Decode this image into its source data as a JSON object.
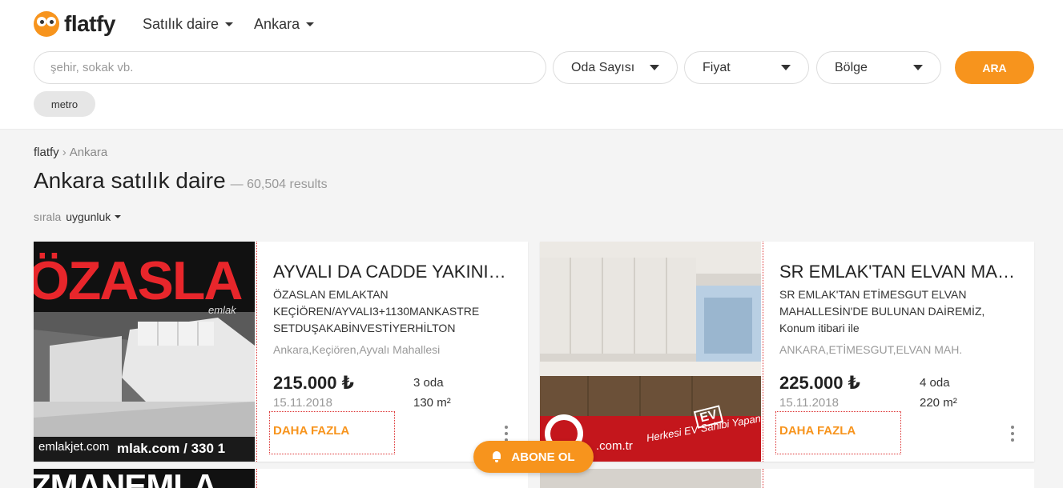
{
  "brand": {
    "name": "flatfy",
    "accent": "#f7941d"
  },
  "nav": {
    "property_type": "Satılık daire",
    "city": "Ankara"
  },
  "search": {
    "placeholder": "şehir, sokak vb.",
    "filters": [
      "Oda Sayısı",
      "Fiyat",
      "Bölge"
    ],
    "submit": "ARA",
    "chip": "metro"
  },
  "breadcrumb": {
    "root": "flatfy",
    "current": "Ankara"
  },
  "page": {
    "title": "Ankara satılık daire",
    "count": "— 60,504 results"
  },
  "sort": {
    "label": "sırala",
    "value": "uygunluk"
  },
  "listings": [
    {
      "title": "AYVALI DA CADDE YAKINI KA...",
      "description": "ÖZASLAN EMLAKTAN KEÇİÖREN/AYVALI3+1130MANKASTRE SETDUŞAKABİNVESTİYERHİLTON",
      "location": "Ankara,Keçiören,Ayvalı Mahallesi",
      "price": "215.000 ₺",
      "date": "15.11.2018",
      "rooms": "3 oda",
      "area": "130 m²",
      "more": "DAHA FAZLA",
      "image_text": "ÖZASLA",
      "image_sub": "emlak",
      "watermark": "emlakjet.com",
      "watermark2": "mlak.com / 330 1"
    },
    {
      "title": "SR EMLAK'TAN ELVAN MAH'...",
      "description": "SR EMLAK'TAN ETİMESGUT ELVAN MAHALLESİN'DE BULUNAN DAİREMİZ, Konum itibari ile",
      "location": "ANKARA,ETİMESGUT,ELVAN MAH.",
      "price": "225.000 ₺",
      "date": "15.11.2018",
      "rooms": "4 oda",
      "area": "220 m²",
      "more": "DAHA FAZLA",
      "watermark": ".com.tr",
      "banner_text": "Herkesi EV Sahibi Yapana Kadar..",
      "banner_logo": "EV"
    }
  ],
  "next_row": {
    "image_text": "ZMANEMLA"
  },
  "subscribe": {
    "label": "ABONE OL"
  }
}
